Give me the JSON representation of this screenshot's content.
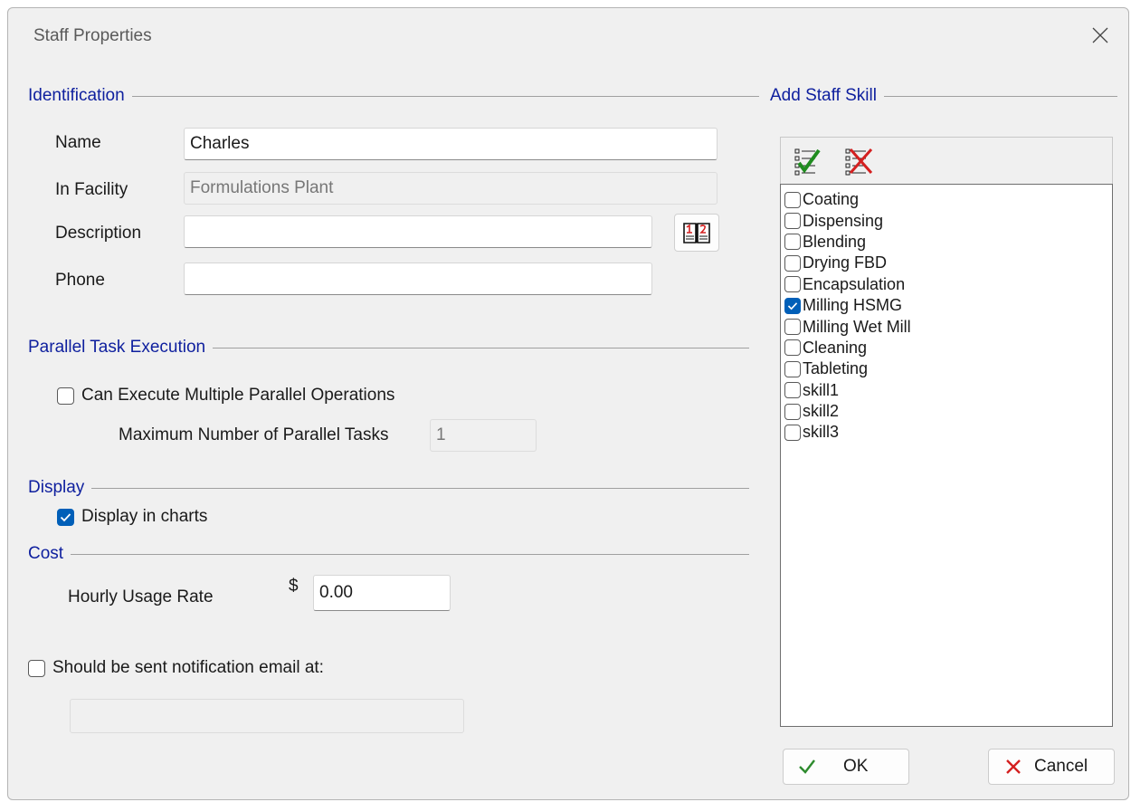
{
  "window": {
    "title": "Staff Properties"
  },
  "identification": {
    "header": "Identification",
    "name_label": "Name",
    "name_value": "Charles",
    "facility_label": "In Facility",
    "facility_value": "Formulations Plant",
    "description_label": "Description",
    "description_value": "",
    "phone_label": "Phone",
    "phone_value": ""
  },
  "parallel": {
    "header": "Parallel Task Execution",
    "multi_label": "Can Execute Multiple Parallel Operations",
    "multi_checked": false,
    "max_label": "Maximum Number of Parallel Tasks",
    "max_value": "1"
  },
  "display": {
    "header": "Display",
    "charts_label": "Display in charts",
    "charts_checked": true
  },
  "cost": {
    "header": "Cost",
    "rate_label": "Hourly Usage Rate",
    "currency": "$",
    "rate_value": "0.00"
  },
  "notification": {
    "label": "Should be sent notification email at:",
    "checked": false,
    "email_value": ""
  },
  "skills": {
    "header": "Add Staff Skill",
    "items": [
      {
        "label": "Coating",
        "checked": false
      },
      {
        "label": "Dispensing",
        "checked": false
      },
      {
        "label": "Blending",
        "checked": false
      },
      {
        "label": "Drying FBD",
        "checked": false
      },
      {
        "label": "Encapsulation",
        "checked": false
      },
      {
        "label": "Milling HSMG",
        "checked": true
      },
      {
        "label": "Milling Wet Mill",
        "checked": false
      },
      {
        "label": "Cleaning",
        "checked": false
      },
      {
        "label": "Tableting",
        "checked": false
      },
      {
        "label": "skill1",
        "checked": false
      },
      {
        "label": "skill2",
        "checked": false
      },
      {
        "label": "skill3",
        "checked": false
      }
    ]
  },
  "buttons": {
    "ok": "OK",
    "cancel": "Cancel"
  },
  "colors": {
    "accent": "#005fb8",
    "section_header": "#0e1f9e",
    "ok_check": "#2e8b2e",
    "cancel_x": "#d42020"
  }
}
